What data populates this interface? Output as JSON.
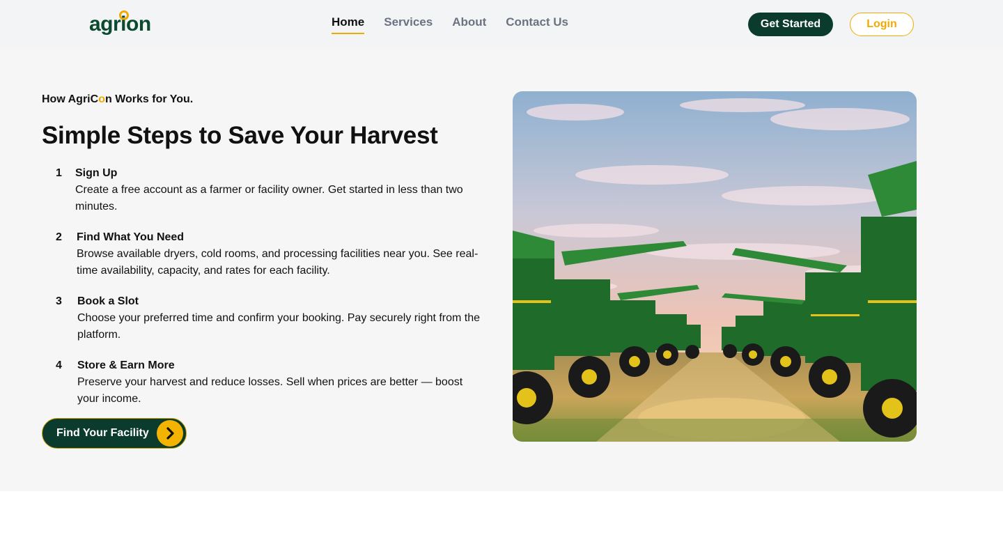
{
  "brand": {
    "name": "agrion"
  },
  "nav": {
    "items": [
      {
        "label": "Home",
        "active": true
      },
      {
        "label": "Services",
        "active": false
      },
      {
        "label": "About",
        "active": false
      },
      {
        "label": "Contact Us",
        "active": false
      }
    ]
  },
  "header": {
    "get_started_label": "Get Started",
    "login_label": "Login"
  },
  "hero_section": {
    "eyebrow_prefix": "How AgriC",
    "eyebrow_accent": "o",
    "eyebrow_suffix": "n Works for You.",
    "title": "Simple Steps to Save Your Harvest",
    "steps": [
      {
        "number": "1",
        "title": "Sign Up",
        "description": "Create a free account as a farmer or facility owner. Get started in less than two minutes."
      },
      {
        "number": "2",
        "title": "Find What You Need",
        "description": "Browse available dryers, cold rooms, and processing facilities near you. See real-time availability, capacity, and rates for each facility."
      },
      {
        "number": "3",
        "title": "Book a Slot",
        "description": "Choose your preferred time and confirm your booking. Pay securely right from the platform."
      },
      {
        "number": "4",
        "title": "Store & Earn More",
        "description": "Preserve your harvest and reduce losses. Sell when prices are better — boost your income."
      }
    ],
    "cta_label": "Find Your Facility"
  },
  "colors": {
    "brand_green": "#0a3b2c",
    "accent_yellow": "#f2a900",
    "header_bg": "#f3f4f6",
    "section_bg": "#f6f6f7"
  }
}
